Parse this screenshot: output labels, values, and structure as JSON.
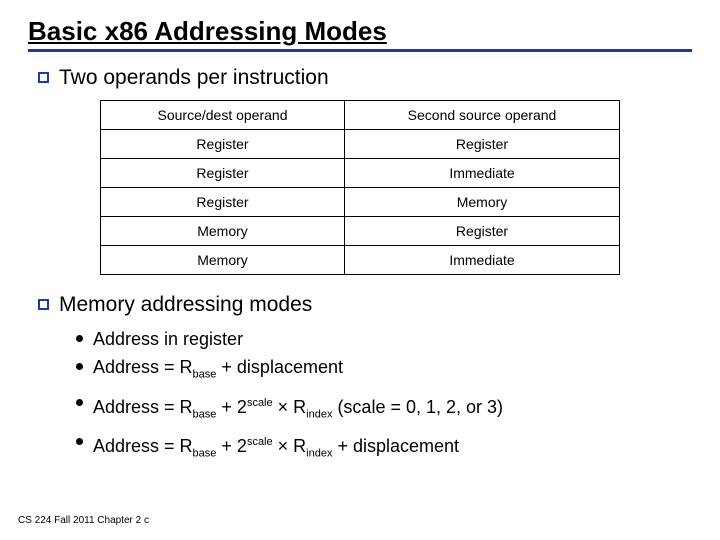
{
  "title": "Basic x86 Addressing Modes",
  "bullet1": "Two operands per instruction",
  "table": {
    "header": [
      "Source/dest operand",
      "Second source operand"
    ],
    "rows": [
      [
        "Register",
        "Register"
      ],
      [
        "Register",
        "Immediate"
      ],
      [
        "Register",
        "Memory"
      ],
      [
        "Memory",
        "Register"
      ],
      [
        "Memory",
        "Immediate"
      ]
    ]
  },
  "bullet2": "Memory addressing modes",
  "mode1": "Address in register",
  "mode2_pre": "Address = R",
  "mode2_sub": "base",
  "mode2_post": " + displacement",
  "mode3_pre": "Address = R",
  "mode3_sub1": "base",
  "mode3_mid1": " + 2",
  "mode3_sup": "scale",
  "mode3_mid2": " × R",
  "mode3_sub2": "index",
  "mode3_post": " (scale = 0, 1, 2, or 3)",
  "mode4_pre": "Address =  R",
  "mode4_sub1": "base",
  "mode4_mid1": " + 2",
  "mode4_sup": "scale",
  "mode4_mid2": " × R",
  "mode4_sub2": "index",
  "mode4_post": " + displacement",
  "footer": "CS 224 Fall 2011 Chapter 2 c",
  "chart_data": {
    "type": "table",
    "title": "Two operands per instruction",
    "columns": [
      "Source/dest operand",
      "Second source operand"
    ],
    "rows": [
      [
        "Register",
        "Register"
      ],
      [
        "Register",
        "Immediate"
      ],
      [
        "Register",
        "Memory"
      ],
      [
        "Memory",
        "Register"
      ],
      [
        "Memory",
        "Immediate"
      ]
    ]
  }
}
